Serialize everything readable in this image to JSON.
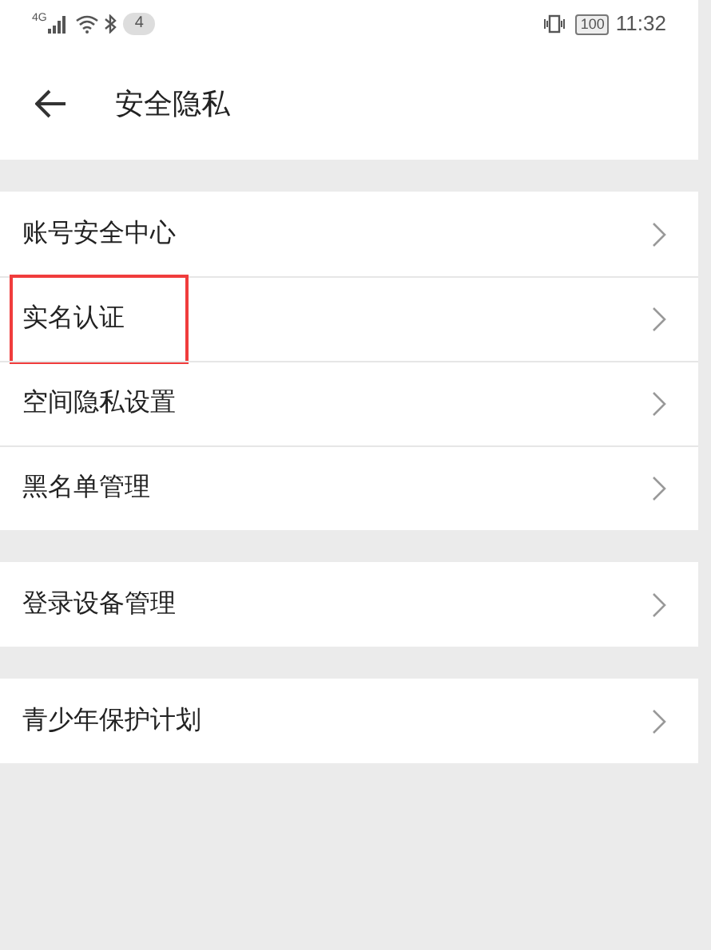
{
  "status_bar": {
    "network": "4G",
    "notification_count": "4",
    "battery": "100",
    "time": "11:32"
  },
  "header": {
    "title": "安全隐私"
  },
  "groups": [
    {
      "items": [
        {
          "label": "账号安全中心",
          "highlighted": false
        },
        {
          "label": "实名认证",
          "highlighted": true
        },
        {
          "label": "空间隐私设置",
          "highlighted": false
        },
        {
          "label": "黑名单管理",
          "highlighted": false
        }
      ]
    },
    {
      "items": [
        {
          "label": "登录设备管理",
          "highlighted": false
        }
      ]
    },
    {
      "items": [
        {
          "label": "青少年保护计划",
          "highlighted": false
        }
      ]
    }
  ]
}
